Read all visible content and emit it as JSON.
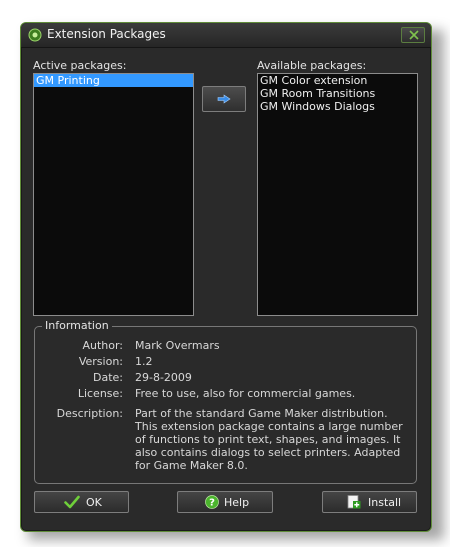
{
  "window": {
    "title": "Extension Packages",
    "accent_color": "#5f8c38"
  },
  "active": {
    "label": "Active packages:",
    "items": [
      "GM Printing"
    ],
    "selected_index": 0
  },
  "available": {
    "label": "Available packages:",
    "items": [
      "GM Color extension",
      "GM Room Transitions",
      "GM Windows Dialogs"
    ]
  },
  "transfer_button": {
    "icon": "arrow-right-icon"
  },
  "information": {
    "title": "Information",
    "author_label": "Author:",
    "author": "Mark Overmars",
    "version_label": "Version:",
    "version": "1.2",
    "date_label": "Date:",
    "date": "29-8-2009",
    "license_label": "License:",
    "license": "Free to use, also for commercial games.",
    "description_label": "Description:",
    "description": "Part of the standard Game Maker distribution. This extension package contains a large number of functions to print text, shapes, and images. It also contains dialogs to select printers. Adapted for Game Maker 8.0."
  },
  "buttons": {
    "ok": "OK",
    "help": "Help",
    "install": "Install"
  }
}
